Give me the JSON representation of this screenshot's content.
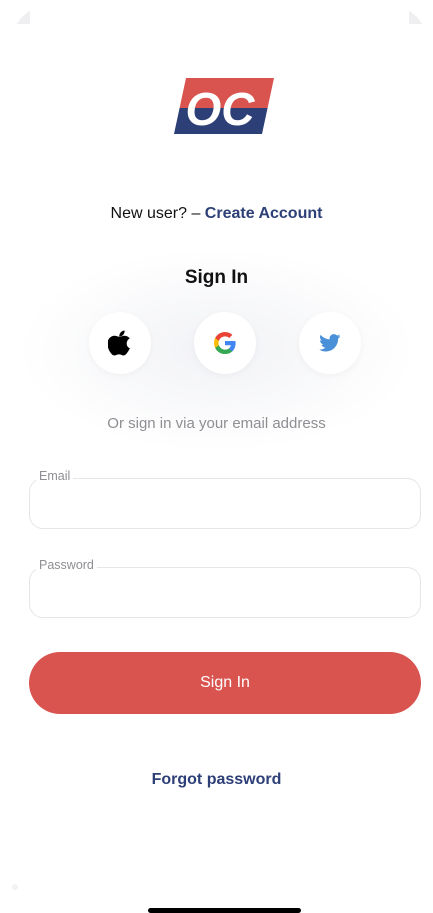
{
  "logo": {
    "text": "OC",
    "colors": {
      "top": "#d9534f",
      "bottom": "#2d3f77",
      "letters": "#ffffff"
    }
  },
  "header": {
    "new_user_prefix": "New user? – ",
    "create_account_label": "Create Account"
  },
  "signin": {
    "title": "Sign In"
  },
  "social": [
    {
      "name": "apple",
      "icon": "apple-icon"
    },
    {
      "name": "google",
      "icon": "google-icon"
    },
    {
      "name": "twitter",
      "icon": "twitter-icon"
    }
  ],
  "or_text": "Or sign in via your email address",
  "form": {
    "email": {
      "label": "Email",
      "value": ""
    },
    "password": {
      "label": "Password",
      "value": ""
    }
  },
  "buttons": {
    "signin_label": "Sign In",
    "forgot_label": "Forgot password"
  },
  "colors": {
    "accent": "#d9534f",
    "link": "#2d3f77",
    "muted": "#8e8e93"
  }
}
